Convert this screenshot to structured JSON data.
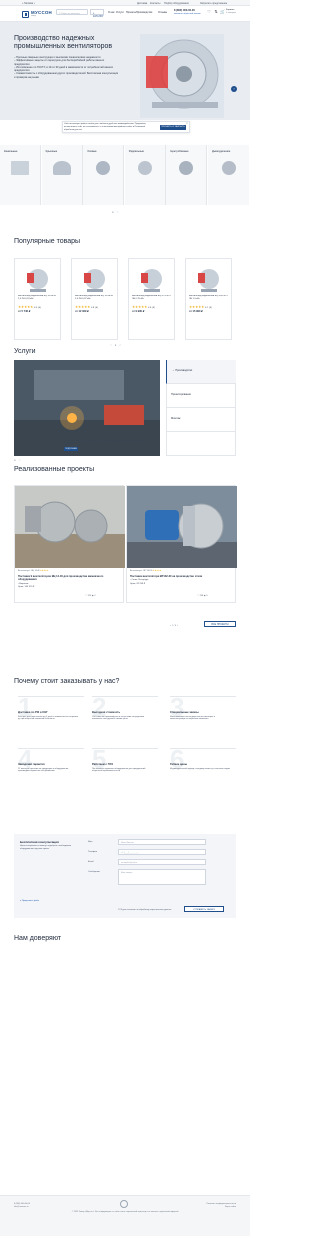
{
  "topbar": {
    "city": "Москва ▾",
    "links": [
      "Доставка",
      "Контакты",
      "Подбор оборудования",
      "Запросить предложение"
    ]
  },
  "header": {
    "logo_title": "МУССОН",
    "logo_sub": "завод",
    "search_placeholder": "Поиск по каталогу",
    "catalog_label": "КАТАЛОГ",
    "nav": [
      "О нас",
      "Услуги",
      "Проекты",
      "Производство",
      "Отзывы"
    ],
    "phone": "8 (800) 000-00-00",
    "callback": "заказать обратный звонок",
    "icons": [
      "heart-icon",
      "compare-icon",
      "cart-icon"
    ],
    "cart_label": "Корзина",
    "cart_count": "0 товаров"
  },
  "hero": {
    "title": "Производство надежных промышленных вентиляторов",
    "bullets": [
      "– Прочные сварные конструкции с высокими показателями надежности",
      "– Эффективные защиты от перегрузок для бесперебойной работы вашего предприятия",
      "– Изготовление по ГОСТУ, в 10-ти 30 дней в зависимости от потребностей вашего предприятия",
      "– Совместимость с оборудованием других производителей. Бесплатная консультация и проверка на рынке"
    ]
  },
  "cookie": {
    "text": "Сайт использует файлы cookie для наиболее удобного взаимодействия. Продолжая использовать сайт, вы соглашаетесь с использованием файлов cookie и Политикой обработки данных",
    "button": "ПРИНЯТЬ И ЗАКРЫТЬ",
    "close": "×"
  },
  "categories": [
    {
      "name": "Канальные"
    },
    {
      "name": "Крышные"
    },
    {
      "name": "Осевые"
    },
    {
      "name": "Радиальные"
    },
    {
      "name": "Центробежные"
    },
    {
      "name": "Дымоудаление"
    }
  ],
  "popular": {
    "heading": "Популярные товары",
    "products": [
      {
        "name": "Вентилятор радиальный ВЦ 14-46 № 2,5 ЛН 0,18 кВт",
        "rating": "4.5",
        "reviews": "(4)",
        "price": "от 5 746 ₽"
      },
      {
        "name": "Вентилятор радиальный ВЦ 14-46 № 2,5 ЛН 0,37 кВт",
        "rating": "4.8",
        "reviews": "(6)",
        "price": "от 12 329 ₽"
      },
      {
        "name": "Вентилятор радиальный ВЦ 4-75 № 4 ЛН 0,75 кВт",
        "rating": "4.6",
        "reviews": "(5)",
        "price": "от 9 990 ₽"
      },
      {
        "name": "Вентилятор радиальный ВЦ 5-45 № 5 ЛН 1,5 кВт",
        "rating": "4.7",
        "reviews": "(3)",
        "price": "от 15 990 ₽"
      }
    ]
  },
  "services": {
    "heading": "Услуги",
    "items": [
      "Производство",
      "Проектирование",
      "Монтаж"
    ],
    "caption": "Собственное производство, которое позволяет выполнять сложные проекты в срок и под ключ",
    "more": "ПОДРОБНЕЕ"
  },
  "projects": {
    "heading": "Реализованные проекты",
    "items": [
      {
        "tag": "Вентиляторы",
        "tag2": "ВЦ 14-46",
        "title": "Поставка 9 вентиляторов ВЦ 14-46 для производства аммиачного оборудования",
        "city": "• Воронеж",
        "price": "Цена: 145 370 ₽",
        "likes": "370",
        "views": "2"
      },
      {
        "tag": "Вентиляторы",
        "tag2": "ВР 132-30",
        "title": "Поставка вентилятора ВР132-30 на производство стали",
        "city": "• Санкт-Петербург",
        "price": "Цена: 92 258 ₽",
        "likes": "258",
        "views": "5"
      }
    ],
    "pager": "1 / 8",
    "all_button": "ВСЕ ПРОЕКТЫ"
  },
  "why": {
    "heading": "Почему стоит заказывать у нас?",
    "items": [
      {
        "num": "1",
        "title": "Доставка по РФ и СНГ",
        "desc": "Быстрая доставка заказа до 5 дней с возможностью отправки до транспортной компании бесплатно"
      },
      {
        "num": "2",
        "title": "Выгодная стоимость",
        "desc": "Собственное производство и отсутствие посредников позволяют нам держать низкие цены"
      },
      {
        "num": "3",
        "title": "Специальные заказы",
        "desc": "Изготавливаем нестандартные вентиляторы и комплектующие по чертежам заказчика"
      },
      {
        "num": "4",
        "title": "Заводская гарантия",
        "desc": "12 месяцев гарантии на продукцию и оборудование, производим сервисное обслуживание"
      },
      {
        "num": "5",
        "title": "Работаем с ГОЗ",
        "desc": "Поставляем надежное оборудование для предприятий оборонной промышленности"
      },
      {
        "num": "6",
        "title": "Гибкие цены",
        "desc": "Индивидуальный подход к каждому клиенту и система скидок"
      }
    ]
  },
  "form": {
    "heading": "Бесплатная консультация",
    "text": "Наши специалисты помогут подобрать необходимое оборудование под ваш проект",
    "labels": [
      "Имя",
      "Телефон",
      "Email",
      "Сообщение"
    ],
    "placeholders": [
      "Иван Иванов",
      "+7 (___) ___-__-__",
      "example@mail.ru",
      "Ваш вопрос"
    ],
    "attach": "Прикрепить файл",
    "consent": "Я даю согласие на обработку персональных данных",
    "submit": "ОТПРАВИТЬ ЗАЯВКУ"
  },
  "trust": {
    "heading": "Нам доверяют"
  },
  "footer": {
    "left": [
      "8 (800) 000-00-00",
      "info@musson.ru"
    ],
    "center": "© 2023 Завод «Муссон». Вся информация на сайте носит справочный характер и не является публичной офертой",
    "right": [
      "Политика конфиденциальности",
      "Карта сайта"
    ]
  },
  "colors": {
    "accent": "#1e4e8c",
    "stars": "#f2b01e",
    "bg_alt": "#f5f6f8"
  }
}
